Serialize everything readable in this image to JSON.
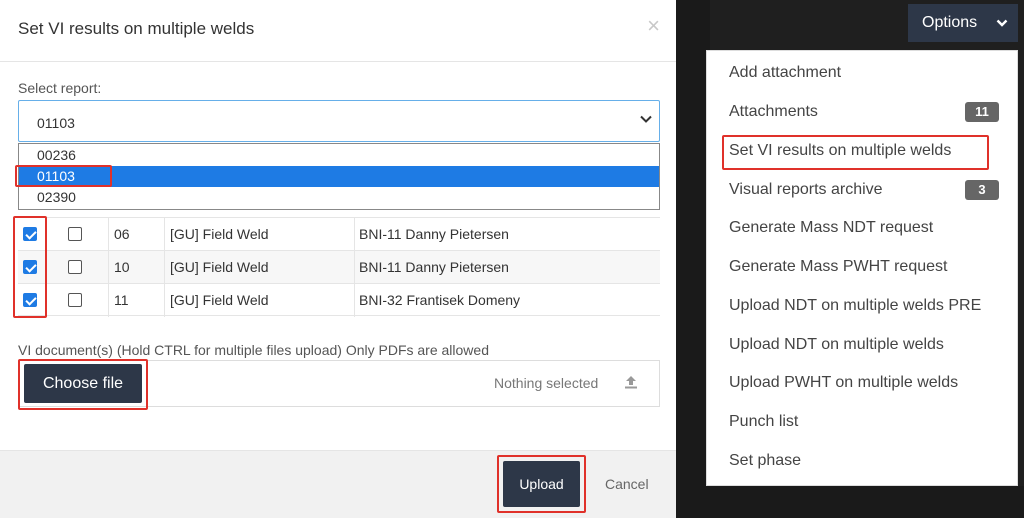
{
  "modal": {
    "title": "Set VI results on multiple welds",
    "close_glyph": "×",
    "select_label": "Select report:",
    "selected_report": "01103",
    "report_options": [
      "00236",
      "01103",
      "02390"
    ],
    "rows": [
      {
        "checked": true,
        "selected": false,
        "weld_no": "06",
        "type": "[GU] Field Weld",
        "welder": "BNI-11 Danny Pietersen"
      },
      {
        "checked": true,
        "selected": false,
        "weld_no": "10",
        "type": "[GU] Field Weld",
        "welder": "BNI-11 Danny Pietersen"
      },
      {
        "checked": true,
        "selected": false,
        "weld_no": "11",
        "type": "[GU] Field Weld",
        "welder": "BNI-32 Frantisek Domeny"
      }
    ],
    "doc_label": "VI document(s) (Hold CTRL for multiple files upload) Only PDFs are allowed",
    "choose_file_label": "Choose file",
    "nothing_selected": "Nothing selected",
    "upload_label": "Upload",
    "cancel_label": "Cancel"
  },
  "options_menu": {
    "button_label": "Options",
    "items": [
      {
        "label": "Add attachment",
        "badge": ""
      },
      {
        "label": "Attachments",
        "badge": "11"
      },
      {
        "label": "Set VI results on multiple welds",
        "badge": ""
      },
      {
        "label": "Visual reports archive",
        "badge": "3"
      },
      {
        "label": "Generate Mass NDT request",
        "badge": ""
      },
      {
        "label": "Generate Mass PWHT request",
        "badge": ""
      },
      {
        "label": "Upload NDT on multiple welds PRE",
        "badge": ""
      },
      {
        "label": "Upload NDT on multiple welds",
        "badge": ""
      },
      {
        "label": "Upload PWHT on multiple welds",
        "badge": ""
      },
      {
        "label": "Punch list",
        "badge": ""
      },
      {
        "label": "Set phase",
        "badge": ""
      }
    ]
  },
  "colors": {
    "highlight_red": "#e0312a",
    "dark_button": "#2d3748",
    "select_blue": "#1e7be4"
  }
}
